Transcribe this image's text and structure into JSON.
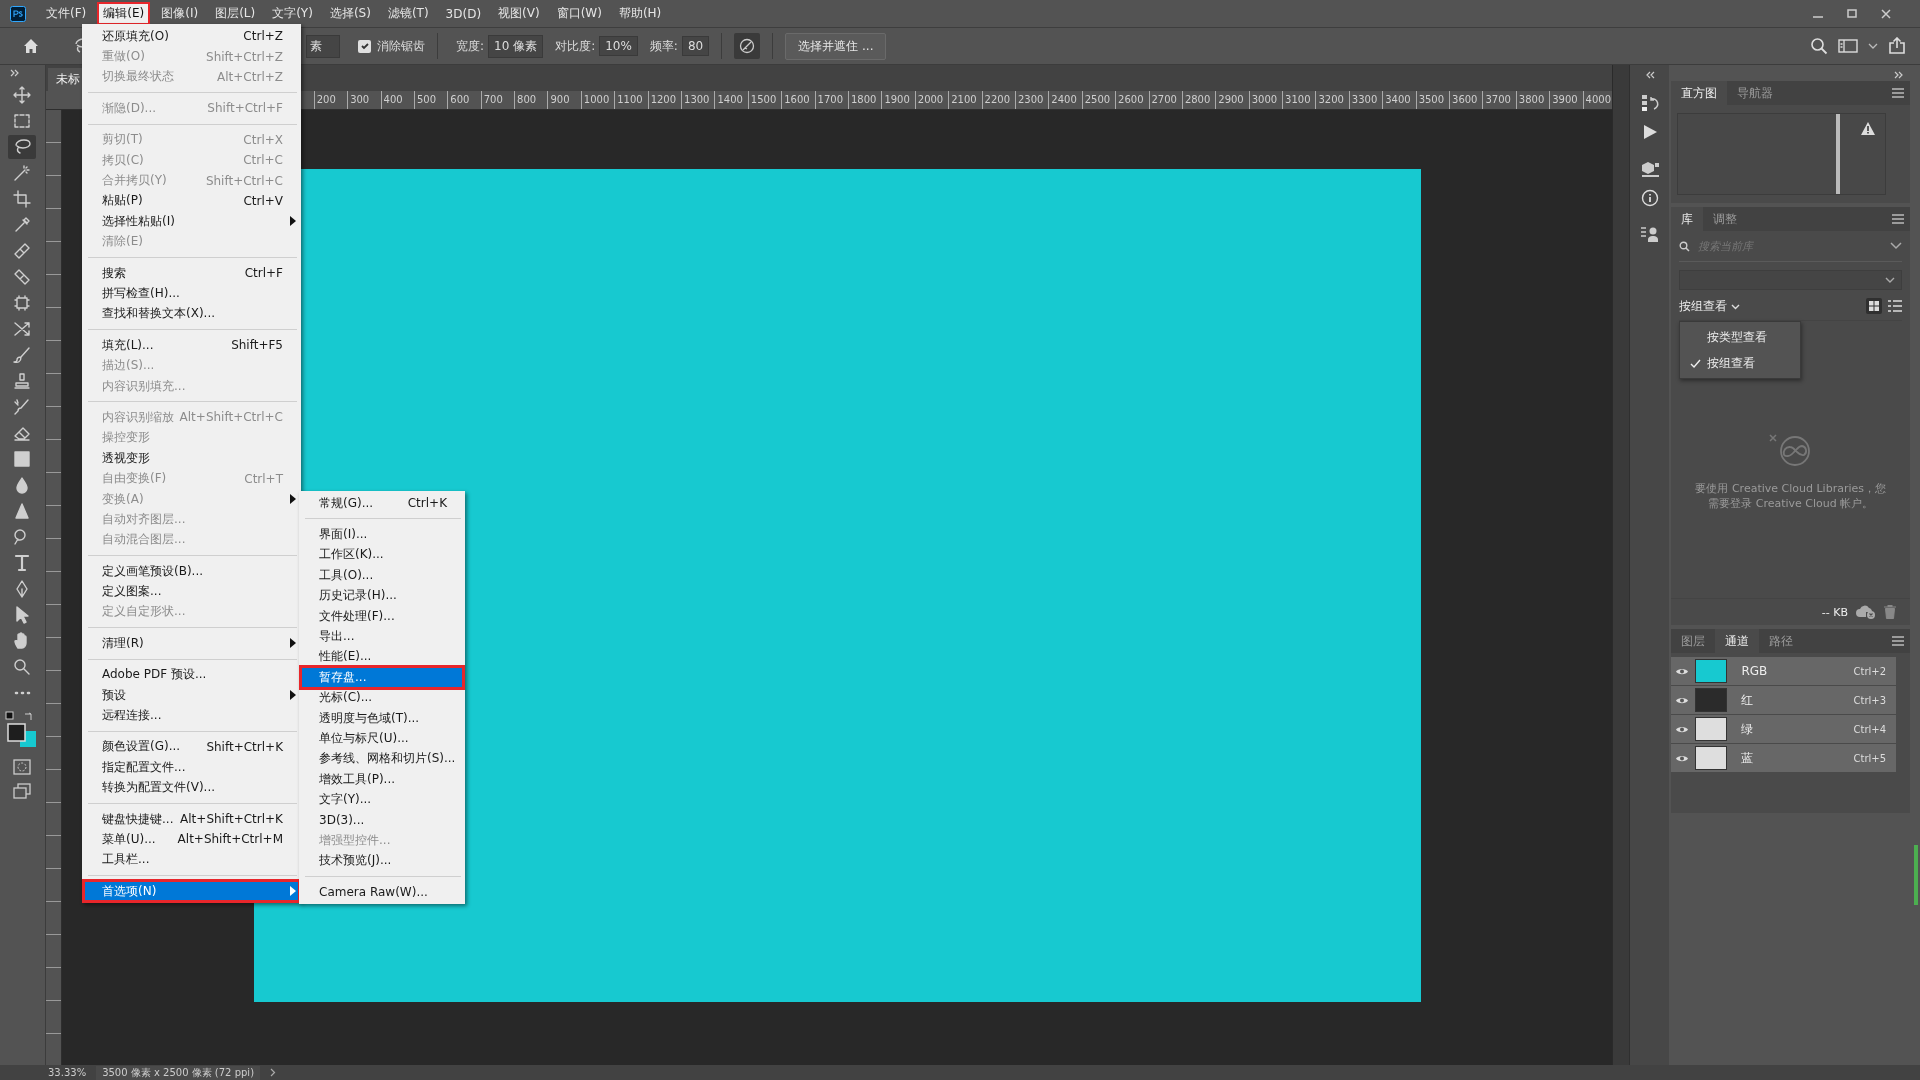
{
  "menubar": [
    {
      "label": "文件(F)",
      "selected": false,
      "outlined": false
    },
    {
      "label": "编辑(E)",
      "selected": true,
      "outlined": true
    },
    {
      "label": "图像(I)",
      "selected": false,
      "outlined": false
    },
    {
      "label": "图层(L)",
      "selected": false,
      "outlined": false
    },
    {
      "label": "文字(Y)",
      "selected": false,
      "outlined": false
    },
    {
      "label": "选择(S)",
      "selected": false,
      "outlined": false
    },
    {
      "label": "滤镜(T)",
      "selected": false,
      "outlined": false
    },
    {
      "label": "3D(D)",
      "selected": false,
      "outlined": false
    },
    {
      "label": "视图(V)",
      "selected": false,
      "outlined": false
    },
    {
      "label": "窗口(W)",
      "selected": false,
      "outlined": false
    },
    {
      "label": "帮助(H)",
      "selected": false,
      "outlined": false
    }
  ],
  "options_bar": {
    "partial_field": "素",
    "antialias": {
      "label": "消除锯齿",
      "checked": true
    },
    "fields": [
      {
        "label": "宽度:",
        "value": "10 像素"
      },
      {
        "label": "对比度:",
        "value": "10%"
      },
      {
        "label": "频率:",
        "value": "80"
      }
    ],
    "select_mask_button": "选择并遮住 ..."
  },
  "tools": [
    {
      "kind": "move",
      "selected": false
    },
    {
      "kind": "marquee",
      "selected": false
    },
    {
      "kind": "lasso",
      "selected": true
    },
    {
      "kind": "wand",
      "selected": false
    },
    {
      "kind": "crop",
      "selected": false
    },
    {
      "kind": "eyedropper",
      "selected": false
    },
    {
      "kind": "healing",
      "selected": false
    },
    {
      "kind": "patch",
      "selected": false
    },
    {
      "kind": "frame",
      "selected": false
    },
    {
      "kind": "cross",
      "selected": false
    },
    {
      "kind": "brush",
      "selected": false
    },
    {
      "kind": "stamp",
      "selected": false
    },
    {
      "kind": "history",
      "selected": false
    },
    {
      "kind": "eraser",
      "selected": false
    },
    {
      "kind": "gradient",
      "selected": false
    },
    {
      "kind": "drop",
      "selected": false
    },
    {
      "kind": "triangle",
      "selected": false
    },
    {
      "kind": "dodge",
      "selected": false
    },
    {
      "kind": "type",
      "selected": false
    },
    {
      "kind": "pen",
      "selected": false
    },
    {
      "kind": "path",
      "selected": false
    },
    {
      "kind": "hand",
      "selected": false
    },
    {
      "kind": "zoom",
      "selected": false
    },
    {
      "kind": "more",
      "selected": false
    }
  ],
  "document": {
    "tab": "未标",
    "ruler_labels": [
      "200",
      "300",
      "400",
      "500",
      "600",
      "700",
      "800",
      "900",
      "1000",
      "1100",
      "1200",
      "1300",
      "1400",
      "1500",
      "1600",
      "1700",
      "1800",
      "1900",
      "2000",
      "2100",
      "2200",
      "2300",
      "2400",
      "2500",
      "2600",
      "2700",
      "2800",
      "2900",
      "3000",
      "3100",
      "3200",
      "3300",
      "3400",
      "3500",
      "3600",
      "3700",
      "3800",
      "3900",
      "4000"
    ]
  },
  "edit_menu": {
    "items": [
      {
        "kind": "item",
        "label": "还原填充(O)",
        "shortcut": "Ctrl+Z",
        "enabled": true,
        "selected": false,
        "outlined": false
      },
      {
        "kind": "item",
        "label": "重做(O)",
        "shortcut": "Shift+Ctrl+Z",
        "enabled": false,
        "selected": false,
        "outlined": false
      },
      {
        "kind": "item",
        "label": "切换最终状态",
        "shortcut": "Alt+Ctrl+Z",
        "enabled": false,
        "selected": false,
        "outlined": false
      },
      {
        "kind": "separator"
      },
      {
        "kind": "item",
        "label": "渐隐(D)...",
        "shortcut": "Shift+Ctrl+F",
        "enabled": false,
        "selected": false,
        "outlined": false
      },
      {
        "kind": "separator"
      },
      {
        "kind": "item",
        "label": "剪切(T)",
        "shortcut": "Ctrl+X",
        "enabled": false,
        "selected": false,
        "outlined": false
      },
      {
        "kind": "item",
        "label": "拷贝(C)",
        "shortcut": "Ctrl+C",
        "enabled": false,
        "selected": false,
        "outlined": false
      },
      {
        "kind": "item",
        "label": "合并拷贝(Y)",
        "shortcut": "Shift+Ctrl+C",
        "enabled": false,
        "selected": false,
        "outlined": false
      },
      {
        "kind": "item",
        "label": "粘贴(P)",
        "shortcut": "Ctrl+V",
        "enabled": true,
        "selected": false,
        "outlined": false
      },
      {
        "kind": "submenu",
        "label": "选择性粘贴(I)",
        "enabled": true,
        "selected": false,
        "outlined": false
      },
      {
        "kind": "item",
        "label": "清除(E)",
        "enabled": false,
        "selected": false,
        "outlined": false
      },
      {
        "kind": "separator"
      },
      {
        "kind": "item",
        "label": "搜索",
        "shortcut": "Ctrl+F",
        "enabled": true,
        "selected": false,
        "outlined": false
      },
      {
        "kind": "item",
        "label": "拼写检查(H)...",
        "enabled": true,
        "selected": false,
        "outlined": false
      },
      {
        "kind": "item",
        "label": "查找和替换文本(X)...",
        "enabled": true,
        "selected": false,
        "outlined": false
      },
      {
        "kind": "separator"
      },
      {
        "kind": "item",
        "label": "填充(L)...",
        "shortcut": "Shift+F5",
        "enabled": true,
        "selected": false,
        "outlined": false
      },
      {
        "kind": "item",
        "label": "描边(S)...",
        "enabled": false,
        "selected": false,
        "outlined": false
      },
      {
        "kind": "item",
        "label": "内容识别填充...",
        "enabled": false,
        "selected": false,
        "outlined": false
      },
      {
        "kind": "separator"
      },
      {
        "kind": "item",
        "label": "内容识别缩放",
        "shortcut": "Alt+Shift+Ctrl+C",
        "enabled": false,
        "selected": false,
        "outlined": false
      },
      {
        "kind": "item",
        "label": "操控变形",
        "enabled": false,
        "selected": false,
        "outlined": false
      },
      {
        "kind": "item",
        "label": "透视变形",
        "enabled": true,
        "selected": false,
        "outlined": false
      },
      {
        "kind": "item",
        "label": "自由变换(F)",
        "shortcut": "Ctrl+T",
        "enabled": false,
        "selected": false,
        "outlined": false
      },
      {
        "kind": "submenu",
        "label": "变换(A)",
        "enabled": false,
        "selected": false,
        "outlined": false
      },
      {
        "kind": "item",
        "label": "自动对齐图层...",
        "enabled": false,
        "selected": false,
        "outlined": false
      },
      {
        "kind": "item",
        "label": "自动混合图层...",
        "enabled": false,
        "selected": false,
        "outlined": false
      },
      {
        "kind": "separator"
      },
      {
        "kind": "item",
        "label": "定义画笔预设(B)...",
        "enabled": true,
        "selected": false,
        "outlined": false
      },
      {
        "kind": "item",
        "label": "定义图案...",
        "enabled": true,
        "selected": false,
        "outlined": false
      },
      {
        "kind": "item",
        "label": "定义自定形状...",
        "enabled": false,
        "selected": false,
        "outlined": false
      },
      {
        "kind": "separator"
      },
      {
        "kind": "submenu",
        "label": "清理(R)",
        "enabled": true,
        "selected": false,
        "outlined": false
      },
      {
        "kind": "separator"
      },
      {
        "kind": "item",
        "label": "Adobe PDF 预设...",
        "enabled": true,
        "selected": false,
        "outlined": false
      },
      {
        "kind": "submenu",
        "label": "预设",
        "enabled": true,
        "selected": false,
        "outlined": false
      },
      {
        "kind": "item",
        "label": "远程连接...",
        "enabled": true,
        "selected": false,
        "outlined": false
      },
      {
        "kind": "separator"
      },
      {
        "kind": "item",
        "label": "颜色设置(G)...",
        "shortcut": "Shift+Ctrl+K",
        "enabled": true,
        "selected": false,
        "outlined": false
      },
      {
        "kind": "item",
        "label": "指定配置文件...",
        "enabled": true,
        "selected": false,
        "outlined": false
      },
      {
        "kind": "item",
        "label": "转换为配置文件(V)...",
        "enabled": true,
        "selected": false,
        "outlined": false
      },
      {
        "kind": "separator"
      },
      {
        "kind": "item",
        "label": "键盘快捷键...",
        "shortcut": "Alt+Shift+Ctrl+K",
        "enabled": true,
        "selected": false,
        "outlined": false
      },
      {
        "kind": "item",
        "label": "菜单(U)...",
        "shortcut": "Alt+Shift+Ctrl+M",
        "enabled": true,
        "selected": false,
        "outlined": false
      },
      {
        "kind": "item",
        "label": "工具栏...",
        "enabled": true,
        "selected": false,
        "outlined": false
      },
      {
        "kind": "separator"
      },
      {
        "kind": "submenu",
        "label": "首选项(N)",
        "enabled": true,
        "selected": true,
        "outlined": true
      }
    ]
  },
  "preferences_menu": {
    "items": [
      {
        "kind": "item",
        "label": "常规(G)...",
        "shortcut": "Ctrl+K",
        "enabled": true,
        "selected": false,
        "outlined": false
      },
      {
        "kind": "separator"
      },
      {
        "kind": "item",
        "label": "界面(I)...",
        "enabled": true,
        "selected": false,
        "outlined": false
      },
      {
        "kind": "item",
        "label": "工作区(K)...",
        "enabled": true,
        "selected": false,
        "outlined": false
      },
      {
        "kind": "item",
        "label": "工具(O)...",
        "enabled": true,
        "selected": false,
        "outlined": false
      },
      {
        "kind": "item",
        "label": "历史记录(H)...",
        "enabled": true,
        "selected": false,
        "outlined": false
      },
      {
        "kind": "item",
        "label": "文件处理(F)...",
        "enabled": true,
        "selected": false,
        "outlined": false
      },
      {
        "kind": "item",
        "label": "导出...",
        "enabled": true,
        "selected": false,
        "outlined": false
      },
      {
        "kind": "item",
        "label": "性能(E)...",
        "enabled": true,
        "selected": false,
        "outlined": false
      },
      {
        "kind": "item",
        "label": "暂存盘...",
        "enabled": true,
        "selected": true,
        "outlined": true
      },
      {
        "kind": "item",
        "label": "光标(C)...",
        "enabled": true,
        "selected": false,
        "outlined": false
      },
      {
        "kind": "item",
        "label": "透明度与色域(T)...",
        "enabled": true,
        "selected": false,
        "outlined": false
      },
      {
        "kind": "item",
        "label": "单位与标尺(U)...",
        "enabled": true,
        "selected": false,
        "outlined": false
      },
      {
        "kind": "item",
        "label": "参考线、网格和切片(S)...",
        "enabled": true,
        "selected": false,
        "outlined": false
      },
      {
        "kind": "item",
        "label": "增效工具(P)...",
        "enabled": true,
        "selected": false,
        "outlined": false
      },
      {
        "kind": "item",
        "label": "文字(Y)...",
        "enabled": true,
        "selected": false,
        "outlined": false
      },
      {
        "kind": "item",
        "label": "3D(3)...",
        "enabled": true,
        "selected": false,
        "outlined": false
      },
      {
        "kind": "item",
        "label": "增强型控件...",
        "enabled": false,
        "selected": false,
        "outlined": false
      },
      {
        "kind": "item",
        "label": "技术预览(J)...",
        "enabled": true,
        "selected": false,
        "outlined": false
      },
      {
        "kind": "separator"
      },
      {
        "kind": "item",
        "label": "Camera Raw(W)...",
        "enabled": true,
        "selected": false,
        "outlined": false
      }
    ]
  },
  "top_panel": {
    "tabs": [
      {
        "label": "直方图",
        "selected": true
      },
      {
        "label": "导航器",
        "selected": false
      }
    ]
  },
  "library_panel": {
    "tabs": [
      {
        "label": "库",
        "selected": true
      },
      {
        "label": "调整",
        "selected": false
      }
    ],
    "search": {
      "placeholder": "搜索当前库"
    },
    "view_dropdown": "按组查看",
    "view_options": [
      {
        "label": "按类型查看",
        "checked": false
      },
      {
        "label": "按组查看",
        "checked": true
      }
    ],
    "message": "要使用 Creative Cloud Libraries，您需要登录 Creative Cloud 帐户。",
    "size": "-- KB"
  },
  "channels_panel": {
    "tabs": [
      {
        "label": "图层",
        "selected": false
      },
      {
        "label": "通道",
        "selected": true
      },
      {
        "label": "路径",
        "selected": false
      }
    ],
    "channels": [
      {
        "name": "RGB",
        "shortcut": "Ctrl+2",
        "color": "#17c9d0",
        "visible": true,
        "selected": true
      },
      {
        "name": "红",
        "shortcut": "Ctrl+3",
        "color": "#2b2b2b",
        "visible": true,
        "selected": true
      },
      {
        "name": "绿",
        "shortcut": "Ctrl+4",
        "color": "#dedede",
        "visible": true,
        "selected": true
      },
      {
        "name": "蓝",
        "shortcut": "Ctrl+5",
        "color": "#dedede",
        "visible": true,
        "selected": true
      }
    ]
  },
  "status_bar": {
    "zoom": "33.33%",
    "size": "3500 像素 x 2500 像素 (72 ppi)"
  }
}
